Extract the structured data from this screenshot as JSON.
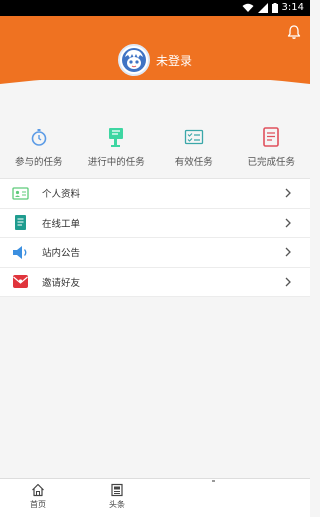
{
  "status_bar": {
    "time": "3:14"
  },
  "header": {
    "login_text": "未登录",
    "bg_color": "#ef7221",
    "avatar_icon": "avatar-face-icon",
    "notify_icon": "bell-icon"
  },
  "tasks": [
    {
      "label": "参与的任务",
      "icon": "timer-icon",
      "color": "#5b9be6"
    },
    {
      "label": "进行中的任务",
      "icon": "flag-icon",
      "color": "#3ed6a2"
    },
    {
      "label": "有效任务",
      "icon": "checklist-icon",
      "color": "#3aa7a9"
    },
    {
      "label": "已完成任务",
      "icon": "book-icon",
      "color": "#e0505c"
    }
  ],
  "menu": [
    {
      "label": "个人资料",
      "icon": "id-card-icon",
      "color": "#5ecb7a"
    },
    {
      "label": "在线工单",
      "icon": "document-icon",
      "color": "#1f9c8f"
    },
    {
      "label": "站内公告",
      "icon": "speaker-icon",
      "color": "#3b8fe0"
    },
    {
      "label": "邀请好友",
      "icon": "gift-envelope-icon",
      "color": "#e0343c"
    }
  ],
  "bottom_nav": [
    {
      "label": "首页",
      "icon": "home-icon"
    },
    {
      "label": "头条",
      "icon": "newspaper-icon"
    }
  ]
}
